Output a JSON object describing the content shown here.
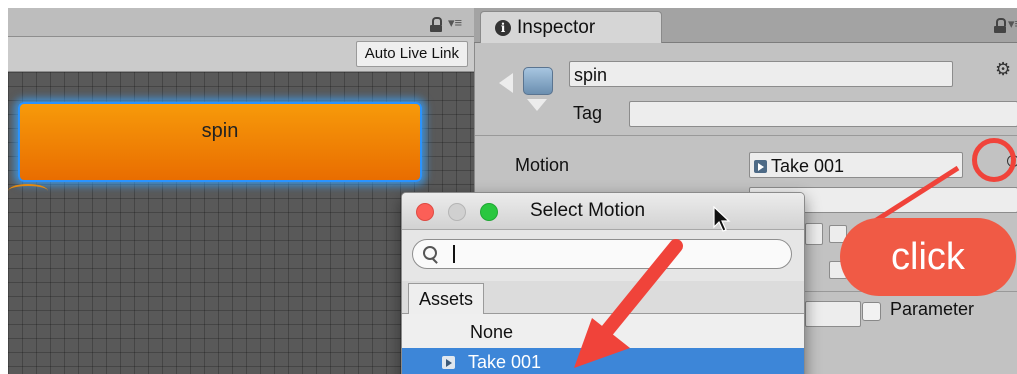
{
  "animator": {
    "auto_live_link_label": "Auto Live Link",
    "state_name": "spin"
  },
  "inspector": {
    "tab_label": "Inspector",
    "state_name": "spin",
    "tag_label": "Tag",
    "tag_value": "",
    "motion_label": "Motion",
    "motion_value": "Take 001",
    "parameter_label": "Parameter"
  },
  "dialog": {
    "title": "Select Motion",
    "search_value": "",
    "tab_label": "Assets",
    "items": [
      {
        "label": "None",
        "selected": false
      },
      {
        "label": "Take 001",
        "selected": true
      }
    ]
  },
  "annotation": {
    "callout_text": "click"
  },
  "colors": {
    "state_node": "#f08400",
    "selection": "#3d86d8",
    "annotation": "#f0433a"
  }
}
